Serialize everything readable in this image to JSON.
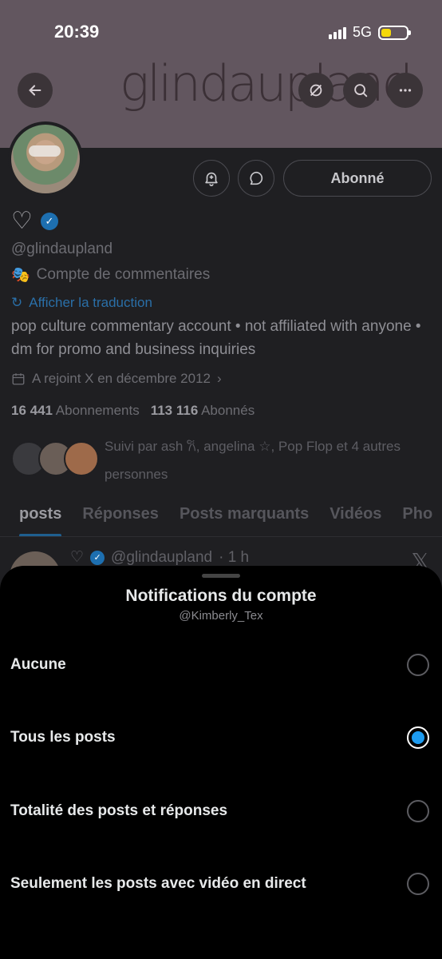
{
  "status_bar": {
    "time": "20:39",
    "network": "5G"
  },
  "banner": {
    "text": "glindaupland"
  },
  "icons": {
    "back": "back-arrow-icon",
    "link": "link-icon",
    "search": "search-icon",
    "more": "more-icon",
    "notify": "bell-icon",
    "message": "message-icon",
    "calendar": "calendar-icon"
  },
  "profile": {
    "name_emoji": "♡",
    "handle": "@glindaupland",
    "category_emoji": "🎭",
    "category": "Compte de commentaires",
    "translate_label": "Afficher la traduction",
    "bio": "pop culture commentary account • not affiliated with anyone • dm for promo and business inquiries",
    "joined": "A rejoint X en décembre 2012",
    "following_count": "16 441",
    "following_label": "Abonnements",
    "followers_count": "113 116",
    "followers_label": "Abonnés",
    "followed_by": "Suivi par ash 𐙚, angelina ☆, Pop Flop et 4 autres personnes",
    "follow_button": "Abonné"
  },
  "tabs": [
    {
      "label": "posts",
      "active": true
    },
    {
      "label": "Réponses"
    },
    {
      "label": "Posts marquants"
    },
    {
      "label": "Vidéos"
    },
    {
      "label": "Pho"
    }
  ],
  "post_peek": {
    "handle": "@glindaupland",
    "time": "· 1 h",
    "heart": "♡",
    "x": "𝕏"
  },
  "sheet": {
    "title": "Notifications du compte",
    "subtitle": "@Kimberly_Tex",
    "options": [
      {
        "label": "Aucune",
        "selected": false
      },
      {
        "label": "Tous les posts",
        "selected": true
      },
      {
        "label": "Totalité des posts et réponses",
        "selected": false
      },
      {
        "label": "Seulement les posts avec vidéo en direct",
        "selected": false
      }
    ]
  },
  "colors": {
    "accent": "#1d9bf0",
    "banner": "#62565f",
    "sheet": "#000000"
  }
}
